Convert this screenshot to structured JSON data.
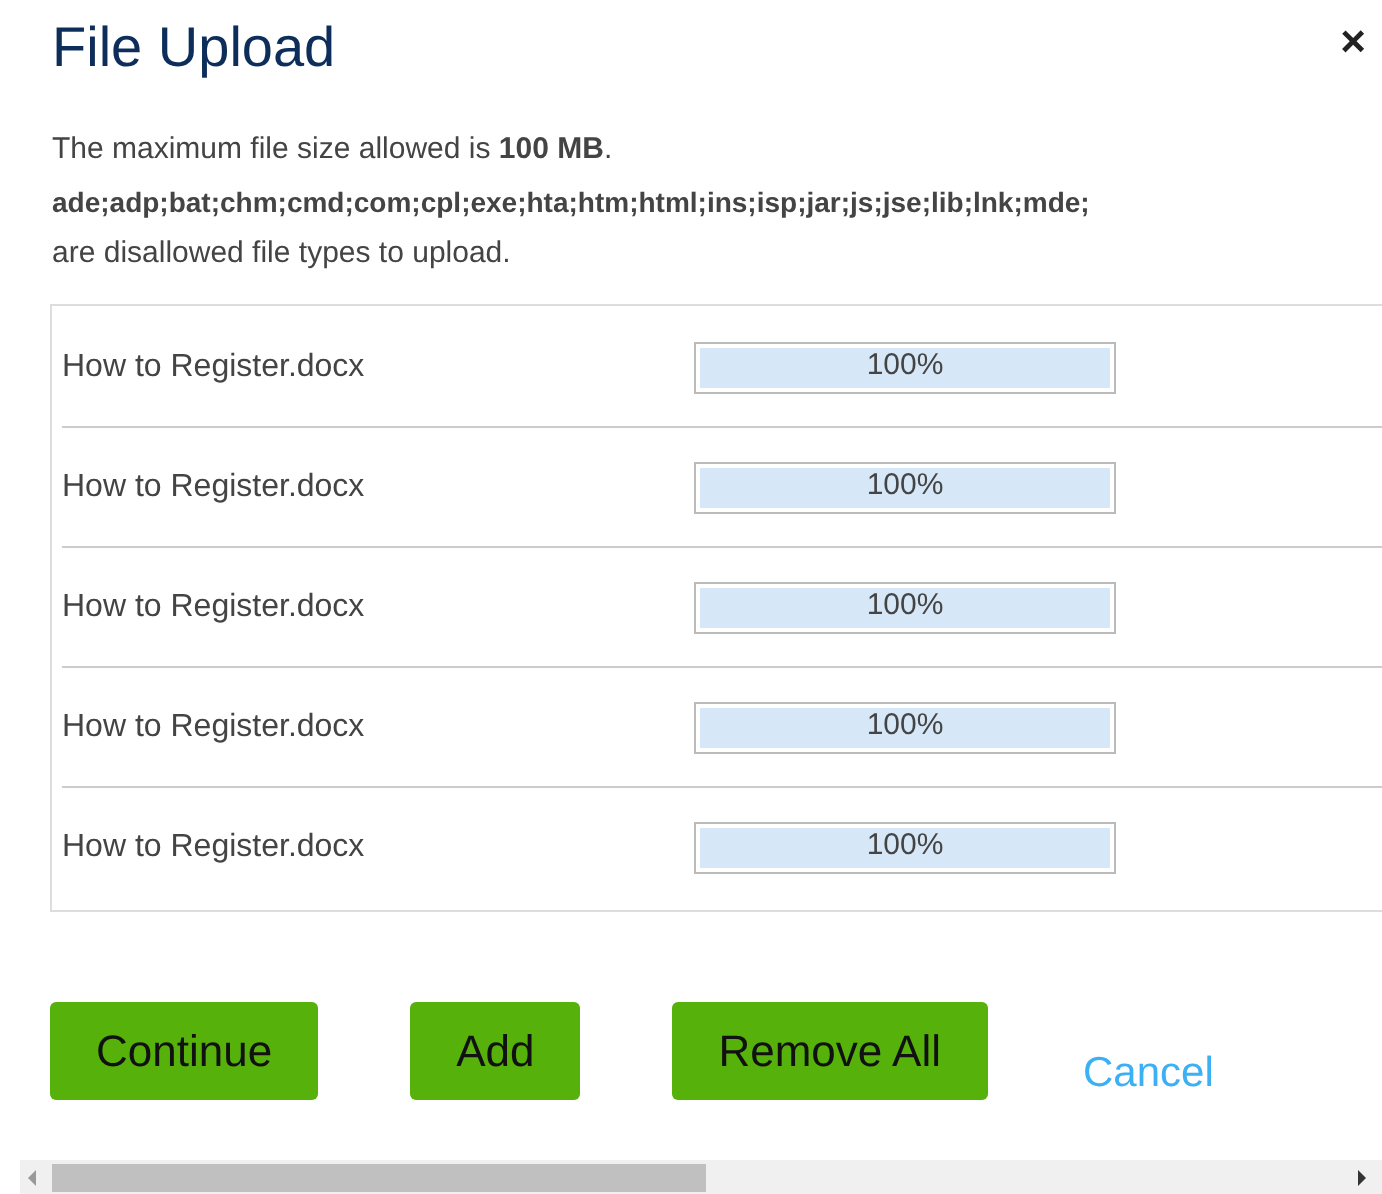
{
  "dialog": {
    "title": "File Upload",
    "close": "×"
  },
  "size_note": "The maximum file size allowed is **100 MB**.",
  "disallowed_types": "ade;adp;bat;chm;cmd;com;cpl;exe;hta;htm;html;ins;isp;jar;js;jse;lib;lnk;mde;",
  "disallowed_note": "are disallowed file types to upload.",
  "files": [
    {
      "name": "How to Register.docx",
      "level": 1,
      "reading": "100%"
    },
    {
      "name": "How to Register.docx",
      "level": 1,
      "reading": "100%"
    },
    {
      "name": "How to Register.docx",
      "level": 1,
      "reading": "100%"
    },
    {
      "name": "How to Register.docx",
      "level": 1,
      "reading": "100%"
    },
    {
      "name": "How to Register.docx",
      "level": 1,
      "reading": "100%"
    }
  ],
  "buttons": [
    "Continue",
    "Add",
    "Remove All"
  ],
  "cancel": "Cancel"
}
